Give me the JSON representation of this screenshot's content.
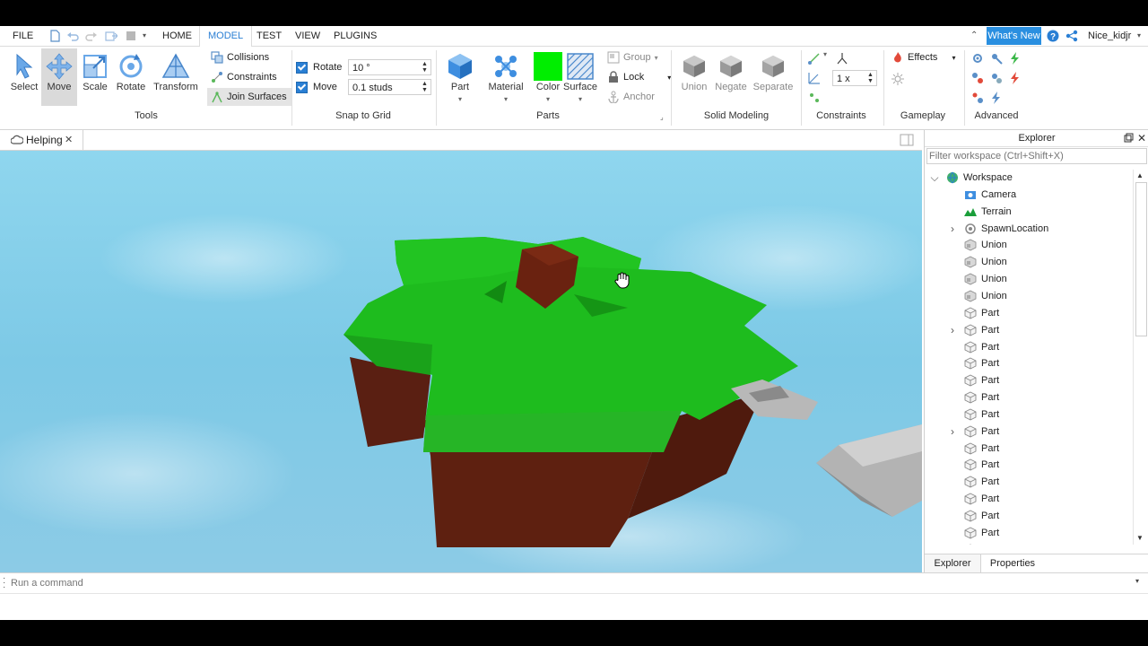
{
  "menu": {
    "file": "FILE",
    "tabs": [
      "HOME",
      "MODEL",
      "TEST",
      "VIEW",
      "PLUGINS"
    ],
    "active_tab": "MODEL",
    "whats_new": "What's New",
    "username": "Nice_kidjr"
  },
  "ribbon": {
    "tools": {
      "title": "Tools",
      "buttons": [
        "Select",
        "Move",
        "Scale",
        "Rotate",
        "Transform"
      ],
      "toggles": [
        "Collisions",
        "Constraints",
        "Join Surfaces"
      ]
    },
    "snap": {
      "title": "Snap to Grid",
      "rotate_label": "Rotate",
      "rotate_value": "10 °",
      "move_label": "Move",
      "move_value": "0.1 studs"
    },
    "parts": {
      "title": "Parts",
      "buttons": [
        "Part",
        "Material",
        "Color",
        "Surface"
      ],
      "small": [
        "Group",
        "Lock",
        "Anchor"
      ],
      "color_swatch": "#00ee00"
    },
    "solid": {
      "title": "Solid Modeling",
      "buttons": [
        "Union",
        "Negate",
        "Separate"
      ]
    },
    "constraints": {
      "title": "Constraints",
      "scale_value": "1 x"
    },
    "gameplay": {
      "title": "Gameplay",
      "effects": "Effects"
    },
    "advanced": {
      "title": "Advanced"
    }
  },
  "document_tab": {
    "label": "Helping",
    "close": "✕"
  },
  "explorer": {
    "title": "Explorer",
    "filter_placeholder": "Filter workspace (Ctrl+Shift+X)",
    "items": [
      {
        "label": "Workspace",
        "icon": "globe-icon",
        "depth": 0,
        "expand": "v"
      },
      {
        "label": "Camera",
        "icon": "camera-icon",
        "depth": 1,
        "expand": ""
      },
      {
        "label": "Terrain",
        "icon": "terrain-icon",
        "depth": 1,
        "expand": ""
      },
      {
        "label": "SpawnLocation",
        "icon": "spawn-icon",
        "depth": 1,
        "expand": ">"
      },
      {
        "label": "Union",
        "icon": "union-icon",
        "depth": 1,
        "expand": ""
      },
      {
        "label": "Union",
        "icon": "union-icon",
        "depth": 1,
        "expand": ""
      },
      {
        "label": "Union",
        "icon": "union-icon",
        "depth": 1,
        "expand": ""
      },
      {
        "label": "Union",
        "icon": "union-icon",
        "depth": 1,
        "expand": ""
      },
      {
        "label": "Part",
        "icon": "part-icon",
        "depth": 1,
        "expand": ""
      },
      {
        "label": "Part",
        "icon": "part-icon",
        "depth": 1,
        "expand": ">"
      },
      {
        "label": "Part",
        "icon": "part-icon",
        "depth": 1,
        "expand": ""
      },
      {
        "label": "Part",
        "icon": "part-icon",
        "depth": 1,
        "expand": ""
      },
      {
        "label": "Part",
        "icon": "part-icon",
        "depth": 1,
        "expand": ""
      },
      {
        "label": "Part",
        "icon": "part-icon",
        "depth": 1,
        "expand": ""
      },
      {
        "label": "Part",
        "icon": "part-icon",
        "depth": 1,
        "expand": ""
      },
      {
        "label": "Part",
        "icon": "part-icon",
        "depth": 1,
        "expand": ">"
      },
      {
        "label": "Part",
        "icon": "part-icon",
        "depth": 1,
        "expand": ""
      },
      {
        "label": "Part",
        "icon": "part-icon",
        "depth": 1,
        "expand": ""
      },
      {
        "label": "Part",
        "icon": "part-icon",
        "depth": 1,
        "expand": ""
      },
      {
        "label": "Part",
        "icon": "part-icon",
        "depth": 1,
        "expand": ""
      },
      {
        "label": "Part",
        "icon": "part-icon",
        "depth": 1,
        "expand": ""
      },
      {
        "label": "Part",
        "icon": "part-icon",
        "depth": 1,
        "expand": ""
      },
      {
        "label": "Part",
        "icon": "part-icon",
        "depth": 1,
        "expand": ""
      }
    ],
    "tabs": [
      "Explorer",
      "Properties"
    ]
  },
  "command_bar": {
    "placeholder": "Run a command"
  }
}
